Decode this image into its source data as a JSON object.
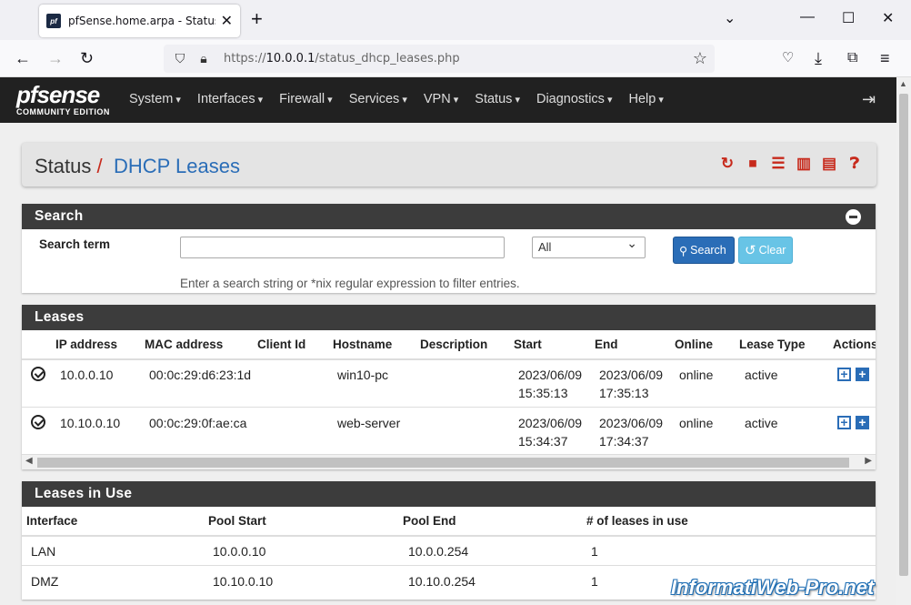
{
  "browser": {
    "tab_title": "pfSense.home.arpa - Status: DH",
    "favicon_text": "pf",
    "url_prefix": "https://",
    "url_host": "10.0.0.1",
    "url_path": "/status_dhcp_leases.php"
  },
  "pfsense": {
    "logo_brand": "pfsense",
    "logo_edition": "COMMUNITY EDITION",
    "menu": [
      "System",
      "Interfaces",
      "Firewall",
      "Services",
      "VPN",
      "Status",
      "Diagnostics",
      "Help"
    ]
  },
  "breadcrumb": {
    "root": "Status",
    "separator": "/",
    "current": "DHCP Leases"
  },
  "search_panel": {
    "title": "Search",
    "label": "Search term",
    "input_value": "",
    "select_value": "All",
    "search_button": "Search",
    "clear_button": "Clear",
    "help_text": "Enter a search string or *nix regular expression to filter entries."
  },
  "leases_panel": {
    "title": "Leases",
    "columns": [
      "IP address",
      "MAC address",
      "Client Id",
      "Hostname",
      "Description",
      "Start",
      "End",
      "Online",
      "Lease Type",
      "Actions"
    ],
    "rows": [
      {
        "ip": "10.0.0.10",
        "mac": "00:0c:29:d6:23:1d",
        "client_id": "",
        "hostname": "win10-pc",
        "description": "",
        "start_date": "2023/06/09",
        "start_time": "15:35:13",
        "end_date": "2023/06/09",
        "end_time": "17:35:13",
        "online": "online",
        "type": "active"
      },
      {
        "ip": "10.10.0.10",
        "mac": "00:0c:29:0f:ae:ca",
        "client_id": "",
        "hostname": "web-server",
        "description": "",
        "start_date": "2023/06/09",
        "start_time": "15:34:37",
        "end_date": "2023/06/09",
        "end_time": "17:34:37",
        "online": "online",
        "type": "active"
      }
    ]
  },
  "inuse_panel": {
    "title": "Leases in Use",
    "columns": [
      "Interface",
      "Pool Start",
      "Pool End",
      "# of leases in use"
    ],
    "rows": [
      {
        "interface": "LAN",
        "pool_start": "10.0.0.10",
        "pool_end": "10.0.0.254",
        "count": "1"
      },
      {
        "interface": "DMZ",
        "pool_start": "10.10.0.10",
        "pool_end": "10.10.0.254",
        "count": "1"
      }
    ]
  },
  "watermark": "InformatiWeb-Pro.net",
  "colors": {
    "accent_red": "#c72a1c",
    "link_blue": "#2a6db7",
    "header_dark": "#3c3c3c",
    "nav_dark": "#212121"
  }
}
